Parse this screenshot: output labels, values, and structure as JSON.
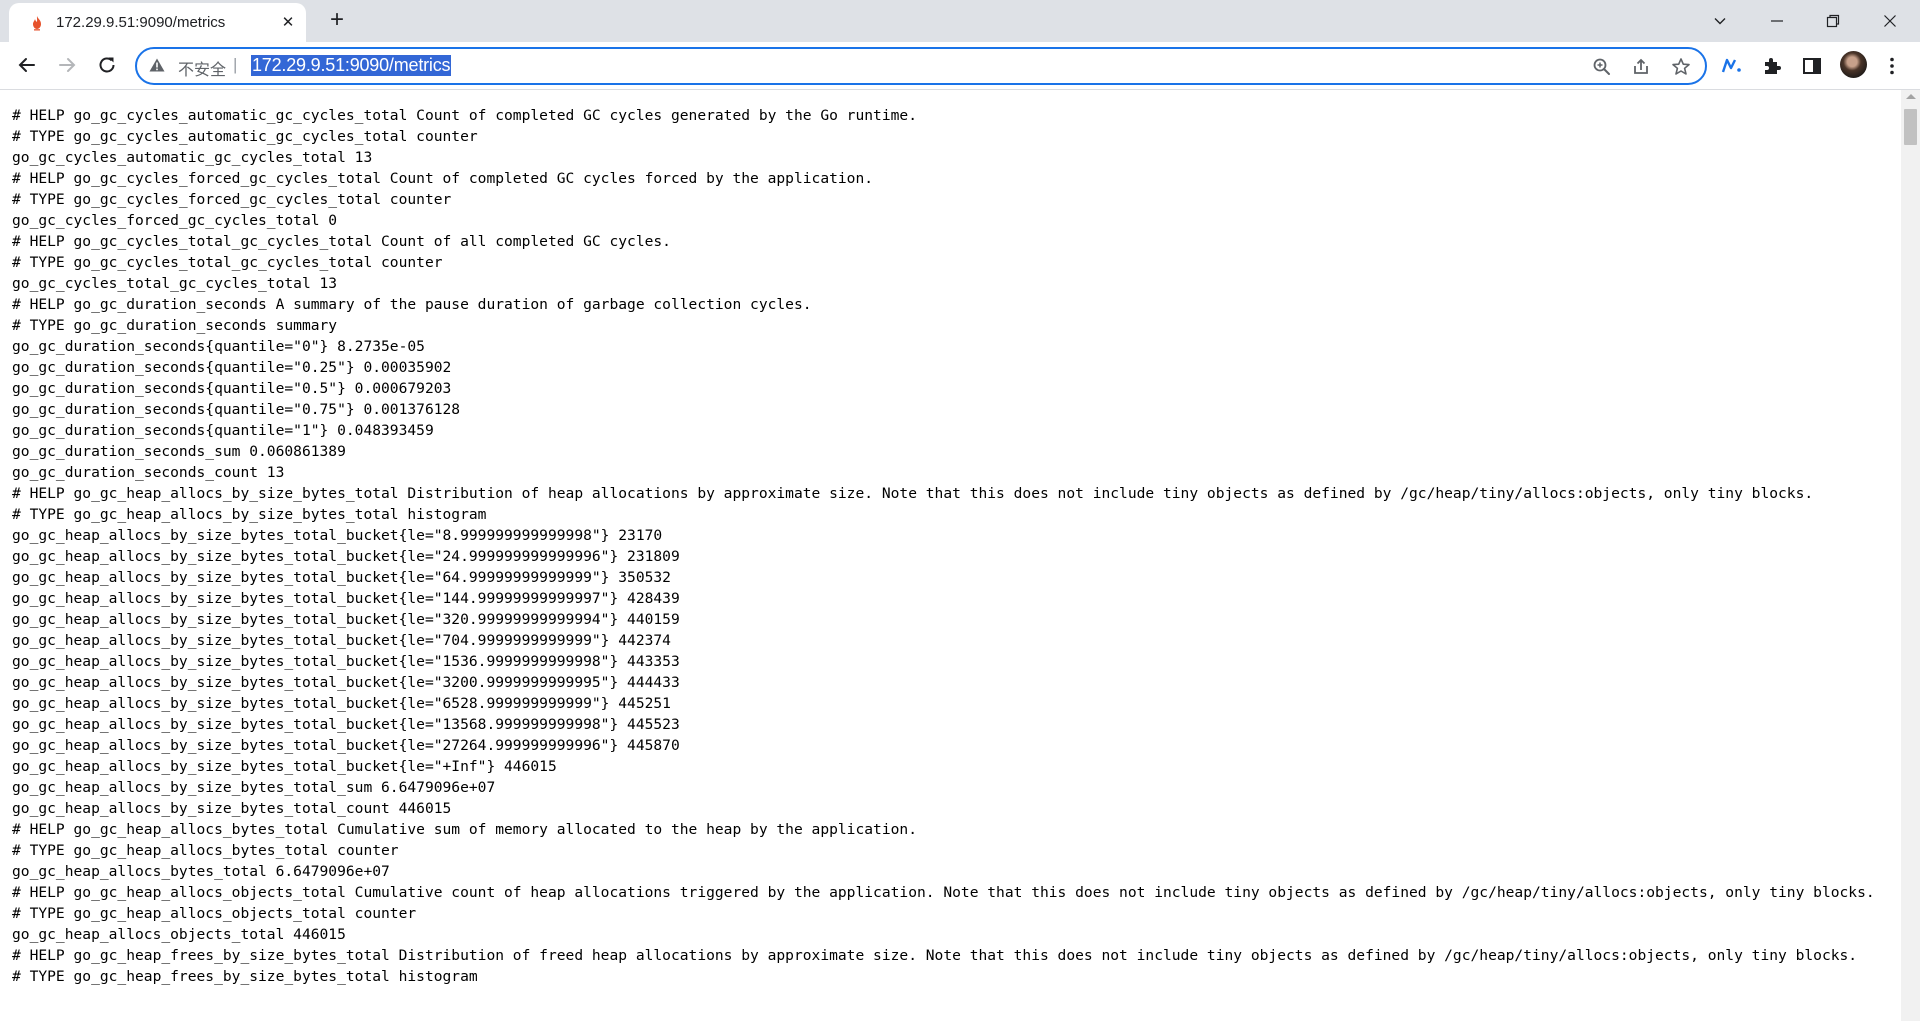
{
  "tab": {
    "title": "172.29.9.51:9090/metrics",
    "favicon": "prometheus-flame-icon",
    "favicon_color": "#e6522c"
  },
  "omnibox": {
    "security_label": "不安全",
    "separator": "|",
    "url": "172.29.9.51:9090/metrics"
  },
  "icons": {
    "back": "arrow-left-icon",
    "forward": "arrow-right-icon",
    "reload": "reload-icon",
    "zoom": "zoom-icon",
    "share": "share-icon",
    "bookmark": "star-icon",
    "extension": "puzzle-icon",
    "sidepanel": "side-panel-icon",
    "menu": "kebab-menu-icon"
  },
  "accent_color": "#1a73e8",
  "metrics_lines": [
    "# HELP go_gc_cycles_automatic_gc_cycles_total Count of completed GC cycles generated by the Go runtime.",
    "# TYPE go_gc_cycles_automatic_gc_cycles_total counter",
    "go_gc_cycles_automatic_gc_cycles_total 13",
    "# HELP go_gc_cycles_forced_gc_cycles_total Count of completed GC cycles forced by the application.",
    "# TYPE go_gc_cycles_forced_gc_cycles_total counter",
    "go_gc_cycles_forced_gc_cycles_total 0",
    "# HELP go_gc_cycles_total_gc_cycles_total Count of all completed GC cycles.",
    "# TYPE go_gc_cycles_total_gc_cycles_total counter",
    "go_gc_cycles_total_gc_cycles_total 13",
    "# HELP go_gc_duration_seconds A summary of the pause duration of garbage collection cycles.",
    "# TYPE go_gc_duration_seconds summary",
    "go_gc_duration_seconds{quantile=\"0\"} 8.2735e-05",
    "go_gc_duration_seconds{quantile=\"0.25\"} 0.00035902",
    "go_gc_duration_seconds{quantile=\"0.5\"} 0.000679203",
    "go_gc_duration_seconds{quantile=\"0.75\"} 0.001376128",
    "go_gc_duration_seconds{quantile=\"1\"} 0.048393459",
    "go_gc_duration_seconds_sum 0.060861389",
    "go_gc_duration_seconds_count 13",
    "# HELP go_gc_heap_allocs_by_size_bytes_total Distribution of heap allocations by approximate size. Note that this does not include tiny objects as defined by /gc/heap/tiny/allocs:objects, only tiny blocks.",
    "# TYPE go_gc_heap_allocs_by_size_bytes_total histogram",
    "go_gc_heap_allocs_by_size_bytes_total_bucket{le=\"8.999999999999998\"} 23170",
    "go_gc_heap_allocs_by_size_bytes_total_bucket{le=\"24.999999999999996\"} 231809",
    "go_gc_heap_allocs_by_size_bytes_total_bucket{le=\"64.99999999999999\"} 350532",
    "go_gc_heap_allocs_by_size_bytes_total_bucket{le=\"144.99999999999997\"} 428439",
    "go_gc_heap_allocs_by_size_bytes_total_bucket{le=\"320.99999999999994\"} 440159",
    "go_gc_heap_allocs_by_size_bytes_total_bucket{le=\"704.9999999999999\"} 442374",
    "go_gc_heap_allocs_by_size_bytes_total_bucket{le=\"1536.9999999999998\"} 443353",
    "go_gc_heap_allocs_by_size_bytes_total_bucket{le=\"3200.9999999999995\"} 444433",
    "go_gc_heap_allocs_by_size_bytes_total_bucket{le=\"6528.999999999999\"} 445251",
    "go_gc_heap_allocs_by_size_bytes_total_bucket{le=\"13568.999999999998\"} 445523",
    "go_gc_heap_allocs_by_size_bytes_total_bucket{le=\"27264.999999999996\"} 445870",
    "go_gc_heap_allocs_by_size_bytes_total_bucket{le=\"+Inf\"} 446015",
    "go_gc_heap_allocs_by_size_bytes_total_sum 6.6479096e+07",
    "go_gc_heap_allocs_by_size_bytes_total_count 446015",
    "# HELP go_gc_heap_allocs_bytes_total Cumulative sum of memory allocated to the heap by the application.",
    "# TYPE go_gc_heap_allocs_bytes_total counter",
    "go_gc_heap_allocs_bytes_total 6.6479096e+07",
    "# HELP go_gc_heap_allocs_objects_total Cumulative count of heap allocations triggered by the application. Note that this does not include tiny objects as defined by /gc/heap/tiny/allocs:objects, only tiny blocks.",
    "# TYPE go_gc_heap_allocs_objects_total counter",
    "go_gc_heap_allocs_objects_total 446015",
    "# HELP go_gc_heap_frees_by_size_bytes_total Distribution of freed heap allocations by approximate size. Note that this does not include tiny objects as defined by /gc/heap/tiny/allocs:objects, only tiny blocks.",
    "# TYPE go_gc_heap_frees_by_size_bytes_total histogram"
  ]
}
